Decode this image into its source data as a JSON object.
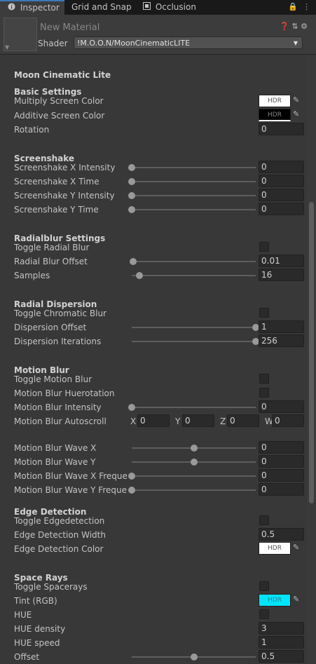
{
  "tabs": [
    {
      "label": "Inspector",
      "icon": "info-icon"
    },
    {
      "label": "Grid and Snap",
      "icon": ""
    },
    {
      "label": "Occlusion",
      "icon": "occlusion-icon"
    }
  ],
  "header": {
    "material_name": "New Material",
    "shader_label": "Shader",
    "shader_value": "!M.O.O.N/MoonCinematicLITE"
  },
  "main_title": "Moon Cinematic Lite",
  "hdr_label": "HDR",
  "colors": {
    "accent": "#3a79bb",
    "tint": "#00e5ff"
  },
  "basic": {
    "title": "Basic Settings",
    "multiply": "Multiply Screen Color",
    "additive": "Additive Screen Color",
    "rotation": "Rotation",
    "rotation_value": "0"
  },
  "screenshake": {
    "title": "Screenshake",
    "rows": [
      {
        "label": "Screenshake X Intensity",
        "value": "0",
        "slider": 0.0
      },
      {
        "label": "Screenshake X Time",
        "value": "0",
        "slider": 0.0
      },
      {
        "label": "Screenshake Y Intensity",
        "value": "0",
        "slider": 0.0
      },
      {
        "label": "Screenshake Y Time",
        "value": "0",
        "slider": 0.0
      }
    ]
  },
  "radialblur": {
    "title": "Radialblur Settings",
    "toggle": "Toggle Radial Blur",
    "offset": "Radial Blur Offset",
    "offset_value": "0.01",
    "offset_slider": 0.01,
    "samples": "Samples",
    "samples_value": "16",
    "samples_slider": 0.06
  },
  "dispersion": {
    "title": "Radial Dispersion",
    "toggle": "Toggle Chromatic Blur",
    "offset": "Dispersion Offset",
    "offset_value": "1",
    "offset_slider": 1.0,
    "iterations": "Dispersion Iterations",
    "iterations_value": "256",
    "iterations_slider": 1.0
  },
  "motionblur": {
    "title": "Motion Blur",
    "toggle": "Toggle Motion Blur",
    "hue": "Motion Blur Huerotation",
    "intensity": "Motion Blur Intensity",
    "intensity_value": "0",
    "intensity_slider": 0.0,
    "autoscroll": "Motion Blur Autoscroll",
    "autoscroll_vec": [
      {
        "axis": "X",
        "value": "0"
      },
      {
        "axis": "Y",
        "value": "0"
      },
      {
        "axis": "Z",
        "value": "0"
      },
      {
        "axis": "W",
        "value": "0"
      }
    ],
    "waves": [
      {
        "label": "Motion Blur Wave X",
        "value": "0",
        "slider": 0.5
      },
      {
        "label": "Motion Blur Wave Y",
        "value": "0",
        "slider": 0.5
      },
      {
        "label": "Motion Blur Wave X Frequency",
        "value": "0",
        "slider": 0.0
      },
      {
        "label": "Motion Blur Wave Y Frequency",
        "value": "0",
        "slider": 0.0
      }
    ]
  },
  "edge": {
    "title": "Edge Detection",
    "toggle": "Toggle Edgedetection",
    "width": "Edge Detection Width",
    "width_value": "0.5",
    "color": "Edge Detection Color"
  },
  "spacerays": {
    "title": "Space Rays",
    "toggle": "Toggle Spacerays",
    "tint": "Tint (RGB)",
    "hue": "HUE",
    "density": "HUE density",
    "density_value": "3",
    "speed": "HUE speed",
    "speed_value": "1",
    "offset": "Offset",
    "offset_value": "0.5",
    "offset_slider": 0.5
  }
}
